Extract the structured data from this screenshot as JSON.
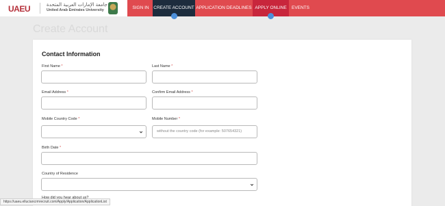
{
  "brand": {
    "logo_text": "UAEU",
    "university_name_ar": "جامعة الإمارات العربية المتحدة",
    "university_name_en": "United Arab Emirates University"
  },
  "nav": {
    "items": [
      {
        "label": "SIGN IN"
      },
      {
        "label": "CREATE ACCOUNT"
      },
      {
        "label": "APPLICATION DEADLINES"
      },
      {
        "label": "APPLY ONLINE"
      },
      {
        "label": "EVENTS"
      }
    ]
  },
  "page": {
    "title": "Create Account"
  },
  "form": {
    "section_title": "Contact Information",
    "required_mark": "*",
    "fields": {
      "first_name": {
        "label": "First Name",
        "value": ""
      },
      "last_name": {
        "label": "Last Name",
        "value": ""
      },
      "email": {
        "label": "Email Address",
        "value": ""
      },
      "confirm_email": {
        "label": "Confirm Email Address",
        "value": ""
      },
      "mobile_country_code": {
        "label": "Mobile Country Code",
        "value": ""
      },
      "mobile_number": {
        "label": "Mobile Number",
        "placeholder": "without the country code (for example: 507654321)"
      },
      "birth_date": {
        "label": "Birth Date",
        "value": ""
      },
      "country_of_residence": {
        "label": "Country of Residence",
        "value": ""
      },
      "how_did_you_hear": {
        "label": "How did you hear about us?"
      }
    }
  },
  "status_bar": {
    "url": "https://uaeu.elluciancrmrecruit.com/Apply/Application/ApplicationList"
  },
  "colors": {
    "header_red": "#e04a4f",
    "active_nav": "#1d2c3d",
    "apply_nav": "#c8263c",
    "indicator_blue": "#4d8fd9"
  }
}
